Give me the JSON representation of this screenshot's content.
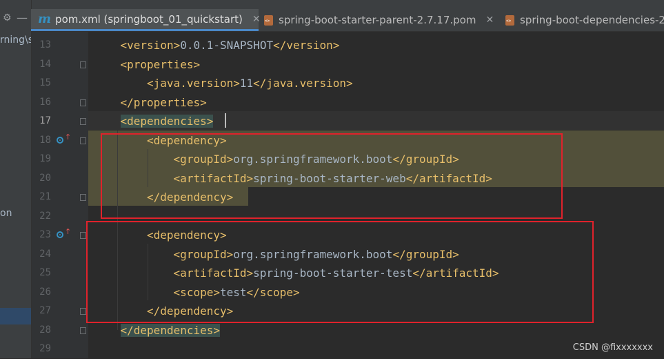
{
  "left_panel": {
    "fragment_top": "rning\\s",
    "fragment_mid": "on"
  },
  "tabs": [
    {
      "label": "pom.xml (springboot_01_quickstart)",
      "icon": "maven-file-icon",
      "active": true
    },
    {
      "label": "spring-boot-starter-parent-2.7.17.pom",
      "icon": "pom-file-icon",
      "active": false
    },
    {
      "label": "spring-boot-dependencies-2",
      "icon": "pom-file-icon",
      "active": false
    }
  ],
  "lines": [
    {
      "num": "13",
      "indent": "    ",
      "parts": [
        [
          "tag",
          "<version>"
        ],
        [
          "txt",
          "0.0.1-SNAPSHOT"
        ],
        [
          "tag",
          "</version>"
        ]
      ]
    },
    {
      "num": "14",
      "indent": "    ",
      "parts": [
        [
          "tag",
          "<properties>"
        ]
      ]
    },
    {
      "num": "15",
      "indent": "        ",
      "parts": [
        [
          "tag",
          "<java.version>"
        ],
        [
          "txt",
          "11"
        ],
        [
          "tag",
          "</java.version>"
        ]
      ]
    },
    {
      "num": "16",
      "indent": "    ",
      "parts": [
        [
          "tag",
          "</properties>"
        ]
      ]
    },
    {
      "num": "17",
      "indent": "    ",
      "parts": [
        [
          "tagbg",
          "<dependencies>"
        ]
      ]
    },
    {
      "num": "18",
      "indent": "        ",
      "parts": [
        [
          "tag",
          "<dependency>"
        ]
      ]
    },
    {
      "num": "19",
      "indent": "            ",
      "parts": [
        [
          "tag",
          "<groupId>"
        ],
        [
          "txt",
          "org.springframework.boot"
        ],
        [
          "tag",
          "</groupId>"
        ]
      ]
    },
    {
      "num": "20",
      "indent": "            ",
      "parts": [
        [
          "tag",
          "<artifactId>"
        ],
        [
          "txt",
          "spring-boot-starter-web"
        ],
        [
          "tag",
          "</artifactId>"
        ]
      ]
    },
    {
      "num": "21",
      "indent": "        ",
      "parts": [
        [
          "tag",
          "</dependency>"
        ]
      ]
    },
    {
      "num": "22",
      "indent": "",
      "parts": []
    },
    {
      "num": "23",
      "indent": "        ",
      "parts": [
        [
          "tag",
          "<dependency>"
        ]
      ]
    },
    {
      "num": "24",
      "indent": "            ",
      "parts": [
        [
          "tag",
          "<groupId>"
        ],
        [
          "txt",
          "org.springframework.boot"
        ],
        [
          "tag",
          "</groupId>"
        ]
      ]
    },
    {
      "num": "25",
      "indent": "            ",
      "parts": [
        [
          "tag",
          "<artifactId>"
        ],
        [
          "txt",
          "spring-boot-starter-test"
        ],
        [
          "tag",
          "</artifactId>"
        ]
      ]
    },
    {
      "num": "26",
      "indent": "            ",
      "parts": [
        [
          "tag",
          "<scope>"
        ],
        [
          "txt",
          "test"
        ],
        [
          "tag",
          "</scope>"
        ]
      ]
    },
    {
      "num": "27",
      "indent": "        ",
      "parts": [
        [
          "tag",
          "</dependency>"
        ]
      ]
    },
    {
      "num": "28",
      "indent": "    ",
      "parts": [
        [
          "tagbg",
          "</dependencies>"
        ]
      ]
    },
    {
      "num": "29",
      "indent": "",
      "parts": []
    }
  ],
  "current_line": "17",
  "gutter_markers": [
    "18",
    "23"
  ],
  "colors": {
    "tag": "#e8bf6a",
    "text": "#a9b7c6",
    "highlight_box": "#e0222b",
    "editor_bg": "#2b2b2b"
  },
  "watermark": "CSDN @fixxxxxxx"
}
